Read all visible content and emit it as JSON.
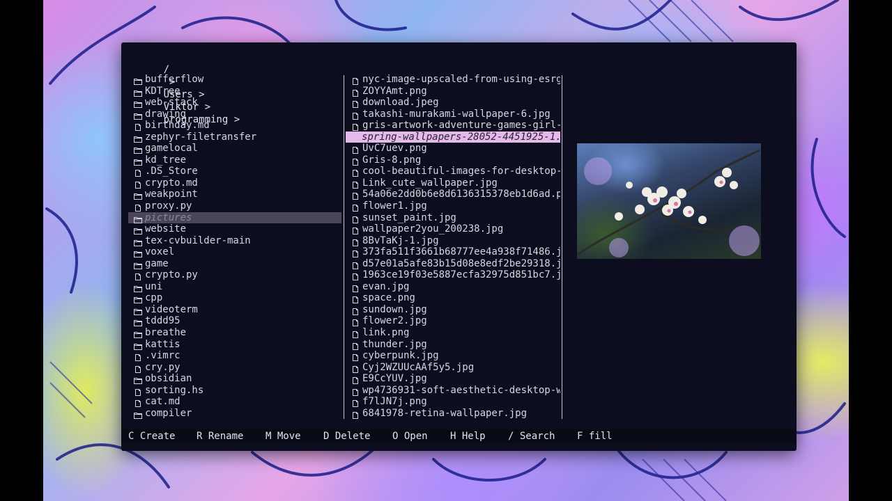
{
  "breadcrumb": {
    "root": "/",
    "separator": ">",
    "parts": [
      "Users",
      "Viktor",
      "programming"
    ]
  },
  "left_pane": {
    "selected_index": 12,
    "items": [
      {
        "name": "bufferflow",
        "type": "folder"
      },
      {
        "name": "KDTree",
        "type": "folder"
      },
      {
        "name": "web-stack",
        "type": "folder"
      },
      {
        "name": "drawing",
        "type": "folder"
      },
      {
        "name": "birthday.md",
        "type": "file"
      },
      {
        "name": "zephyr-filetransfer",
        "type": "folder"
      },
      {
        "name": "gamelocal",
        "type": "folder"
      },
      {
        "name": "kd_tree",
        "type": "folder"
      },
      {
        "name": ".DS_Store",
        "type": "file"
      },
      {
        "name": "crypto.md",
        "type": "file"
      },
      {
        "name": "weakpoint",
        "type": "folder"
      },
      {
        "name": "proxy.py",
        "type": "file"
      },
      {
        "name": "pictures",
        "type": "folder"
      },
      {
        "name": "website",
        "type": "folder"
      },
      {
        "name": "tex-cvbuilder-main",
        "type": "folder"
      },
      {
        "name": "voxel",
        "type": "folder"
      },
      {
        "name": "game",
        "type": "folder"
      },
      {
        "name": "crypto.py",
        "type": "file"
      },
      {
        "name": "uni",
        "type": "folder"
      },
      {
        "name": "cpp",
        "type": "folder"
      },
      {
        "name": "videoterm",
        "type": "folder"
      },
      {
        "name": "tddd95",
        "type": "folder"
      },
      {
        "name": "breathe",
        "type": "folder"
      },
      {
        "name": "kattis",
        "type": "folder"
      },
      {
        "name": ".vimrc",
        "type": "file"
      },
      {
        "name": "cry.py",
        "type": "file"
      },
      {
        "name": "obsidian",
        "type": "folder"
      },
      {
        "name": "sorting.hs",
        "type": "file"
      },
      {
        "name": "cat.md",
        "type": "file"
      },
      {
        "name": "compiler",
        "type": "folder"
      }
    ]
  },
  "middle_pane": {
    "selected_index": 5,
    "items": [
      "nyc-image-upscaled-from-using-esrg",
      "ZOYYAmt.png",
      "download.jpeg",
      "takashi-murakami-wallpaper-6.jpg",
      "gris-artwork-adventure-games-girl-",
      "spring-wallpapers-28052-4451925-1.",
      "UvC7uev.png",
      "Gris-8.png",
      "cool-beautiful-images-for-desktop-",
      "Link_cute_wallpaper.jpg",
      "54a06e2dd0b6e8d6136315378eb1d6ad.p",
      "flower1.jpg",
      "sunset_paint.jpg",
      "wallpaper2you_200238.jpg",
      "8BvTaKj-1.jpg",
      "373fa511f3661b68777ee4a938f71486.j",
      "d57e01a5afe83b15d08e8edf2be29318.j",
      "1963ce19f03e5887ecfa32975d851bc7.j",
      "evan.jpg",
      "space.png",
      "sundown.jpg",
      "flower2.jpg",
      "link.png",
      "thunder.jpg",
      "cyberpunk.jpg",
      "Cyj2WZUUcAAf5y5.jpg",
      "E9CcYUV.jpg",
      "wp4736931-soft-aesthetic-desktop-w",
      "f7lJN7j.png",
      "6841978-retina-wallpaper.jpg"
    ]
  },
  "status_bar": {
    "commands": [
      {
        "key": "C",
        "label": "Create"
      },
      {
        "key": "R",
        "label": "Rename"
      },
      {
        "key": "M",
        "label": "Move"
      },
      {
        "key": "D",
        "label": "Delete"
      },
      {
        "key": "O",
        "label": "Open"
      },
      {
        "key": "H",
        "label": "Help"
      },
      {
        "key": "/",
        "label": "Search"
      },
      {
        "key": "F",
        "label": "fill"
      }
    ]
  },
  "colors": {
    "window_bg": "#0c0d1f",
    "text": "#d7d7e0",
    "selected_file_bg": "#e5b9ea",
    "selected_dir_bg": "#4a4558"
  },
  "icons": {
    "folder": "folder-icon",
    "file": "file-icon"
  }
}
